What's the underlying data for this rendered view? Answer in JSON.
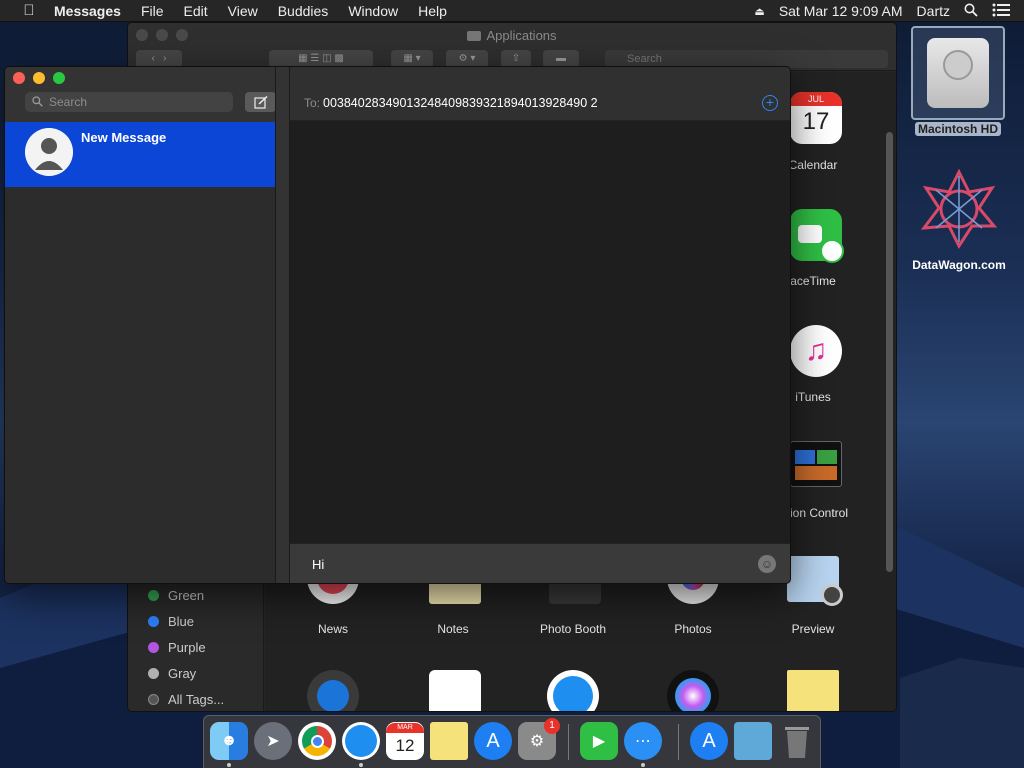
{
  "menubar": {
    "app": "Messages",
    "items": [
      "File",
      "Edit",
      "View",
      "Buddies",
      "Window",
      "Help"
    ],
    "datetime": "Sat Mar 12  9:09 AM",
    "user": "Dartz"
  },
  "finder": {
    "title": "Applications",
    "search_placeholder": "Search",
    "tags": [
      "Green",
      "Blue",
      "Purple",
      "Gray",
      "All Tags..."
    ],
    "tag_colors": [
      "#34a853",
      "#2d7ff9",
      "#b255e0",
      "#b0b0b0",
      "#555555"
    ],
    "apps_right_column": [
      "Calendar",
      "FaceTime",
      "iTunes",
      "Mission Control"
    ],
    "apps_right_column_visible_text": [
      "Calendar",
      "aceTime",
      "iTunes",
      "ssion Control"
    ],
    "apps_bottom_row": [
      "News",
      "Notes",
      "Photo Booth",
      "Photos",
      "Preview"
    ],
    "calendar_month": "JUL",
    "calendar_day": "17"
  },
  "desktop": {
    "items": [
      {
        "label": "Macintosh HD"
      },
      {
        "label": "DataWagon.com"
      }
    ]
  },
  "messages": {
    "search_placeholder": "Search",
    "conversation_title": "New Message",
    "to_label": "To:",
    "to_value": "00384028349013248409839321894013928490 2",
    "compose_text": "Hi"
  },
  "dock": {
    "apps": [
      "Finder",
      "Launchpad",
      "Chrome",
      "Safari",
      "Calendar",
      "Notes",
      "App Store",
      "System Preferences",
      "FaceTime",
      "Messages",
      "App Store",
      "Folder",
      "Trash"
    ],
    "calendar_month": "MAR",
    "calendar_day": "12",
    "sysprefs_badge": "1"
  },
  "colors": {
    "selection_blue": "#0b46d6",
    "accent_blue": "#2f86f0",
    "traffic_red": "#fe5f57",
    "traffic_yellow": "#febc2e",
    "traffic_green": "#28c840"
  }
}
